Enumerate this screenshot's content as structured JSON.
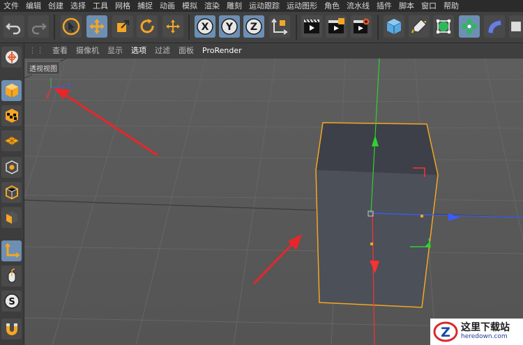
{
  "menu": [
    "文件",
    "编辑",
    "创建",
    "选择",
    "工具",
    "网格",
    "捕捉",
    "动画",
    "模拟",
    "渲染",
    "雕刻",
    "运动跟踪",
    "运动图形",
    "角色",
    "流水线",
    "插件",
    "脚本",
    "窗口",
    "帮助"
  ],
  "viewport_menu": [
    "查看",
    "摄像机",
    "显示",
    "选项",
    "过滤",
    "面板",
    "ProRender"
  ],
  "viewport_label": "透视视图",
  "axis_label_z": "Z",
  "axis_label_x": "X",
  "toolbar_tools": [
    "undo-icon",
    "redo-icon",
    "select-arrow-icon",
    "move-icon",
    "scale-icon",
    "rotate-icon",
    "move-plus-icon",
    "x-axis-icon",
    "y-axis-icon",
    "z-axis-icon",
    "coordinate-system-icon",
    "render-view-icon",
    "render-picture-queue-icon",
    "render-settings-icon",
    "cube-object-icon",
    "pen-tool-icon",
    "subdivision-icon",
    "array-cloner-icon",
    "deformer-icon"
  ],
  "axis_letters": {
    "x": "X",
    "y": "Y",
    "z": "Z"
  },
  "watermark": {
    "title": "这里下载站",
    "site": "heredown.com",
    "logo_letter": "Z"
  },
  "colors": {
    "accent": "#f5a623",
    "active": "#6d8fb3",
    "x_axis": "#ff3030",
    "y_axis": "#30d030",
    "z_axis": "#3a5cff"
  }
}
